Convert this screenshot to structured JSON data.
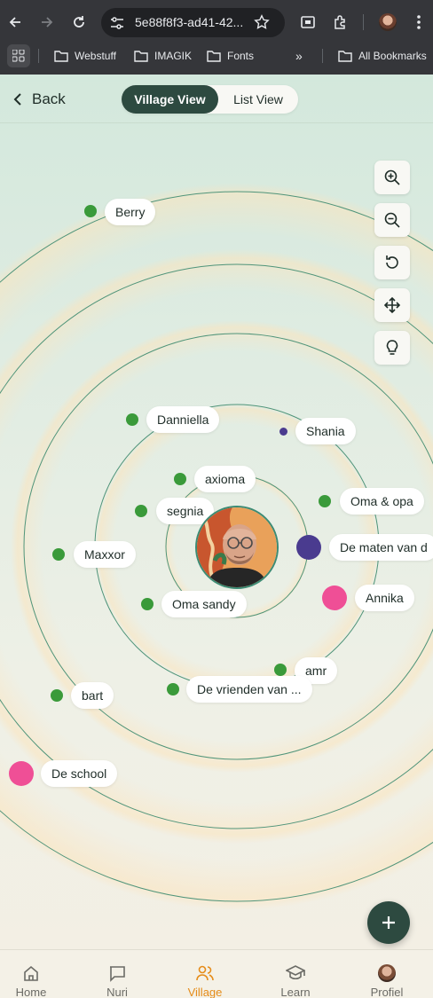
{
  "browser": {
    "url": "5e88f8f3-ad41-42...",
    "bookmarks": [
      "Webstuff",
      "IMAGIK",
      "Fonts"
    ],
    "all_bookmarks": "All Bookmarks"
  },
  "header": {
    "back_label": "Back",
    "view_toggle": {
      "active": "Village View",
      "inactive": "List View"
    }
  },
  "colors": {
    "primary": "#2d4a40",
    "ring": "#4f9479",
    "green_dot": "#3a9a3a",
    "purple_dot": "#4a3b8f",
    "pink_dot": "#ef4f96",
    "nav_active": "#e58c1a"
  },
  "people": [
    {
      "name": "Berry",
      "dot": "green"
    },
    {
      "name": "Danniella",
      "dot": "green"
    },
    {
      "name": "Shania",
      "dot": "purple"
    },
    {
      "name": "axioma",
      "dot": "green"
    },
    {
      "name": "segnia",
      "dot": "green"
    },
    {
      "name": "Oma & opa",
      "dot": "green"
    },
    {
      "name": "Maxxor",
      "dot": "green"
    },
    {
      "name": "De maten van d",
      "dot": "purple"
    },
    {
      "name": "Annika",
      "dot": "pink"
    },
    {
      "name": "Oma sandy",
      "dot": "green"
    },
    {
      "name": "amr",
      "dot": "green"
    },
    {
      "name": "bart",
      "dot": "green"
    },
    {
      "name": "De vrienden van ...",
      "dot": "green"
    },
    {
      "name": "De school",
      "dot": "pink"
    }
  ],
  "controls": [
    "zoom-in-icon",
    "zoom-out-icon",
    "reset-icon",
    "move-icon",
    "lightbulb-icon"
  ],
  "nav": {
    "items": [
      {
        "label": "Home",
        "icon": "home-icon"
      },
      {
        "label": "Nuri",
        "icon": "chat-icon"
      },
      {
        "label": "Village",
        "icon": "people-icon",
        "active": true
      },
      {
        "label": "Learn",
        "icon": "graduation-cap-icon"
      },
      {
        "label": "Profiel",
        "icon": "avatar"
      }
    ]
  }
}
